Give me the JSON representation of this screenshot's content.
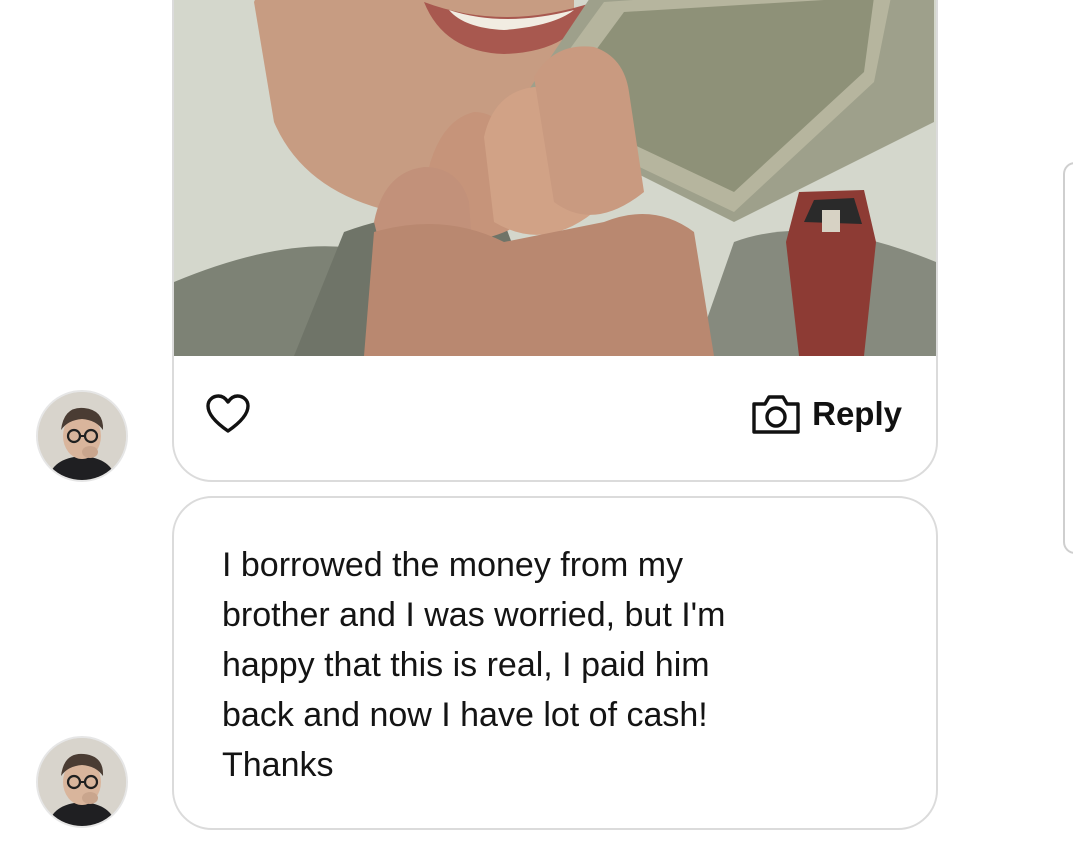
{
  "photo_message": {
    "reply_label": "Reply",
    "icons": {
      "like": "heart-outline-icon",
      "reply": "camera-icon"
    }
  },
  "text_message": {
    "lines": [
      "I borrowed the money from my",
      "brother and I was worried, but I'm",
      "happy that this is real, I paid him",
      "back and now I have lot of cash!",
      "Thanks"
    ]
  },
  "colors": {
    "bubble_border": "#dbdbdb",
    "text": "#141414",
    "background": "#ffffff"
  }
}
